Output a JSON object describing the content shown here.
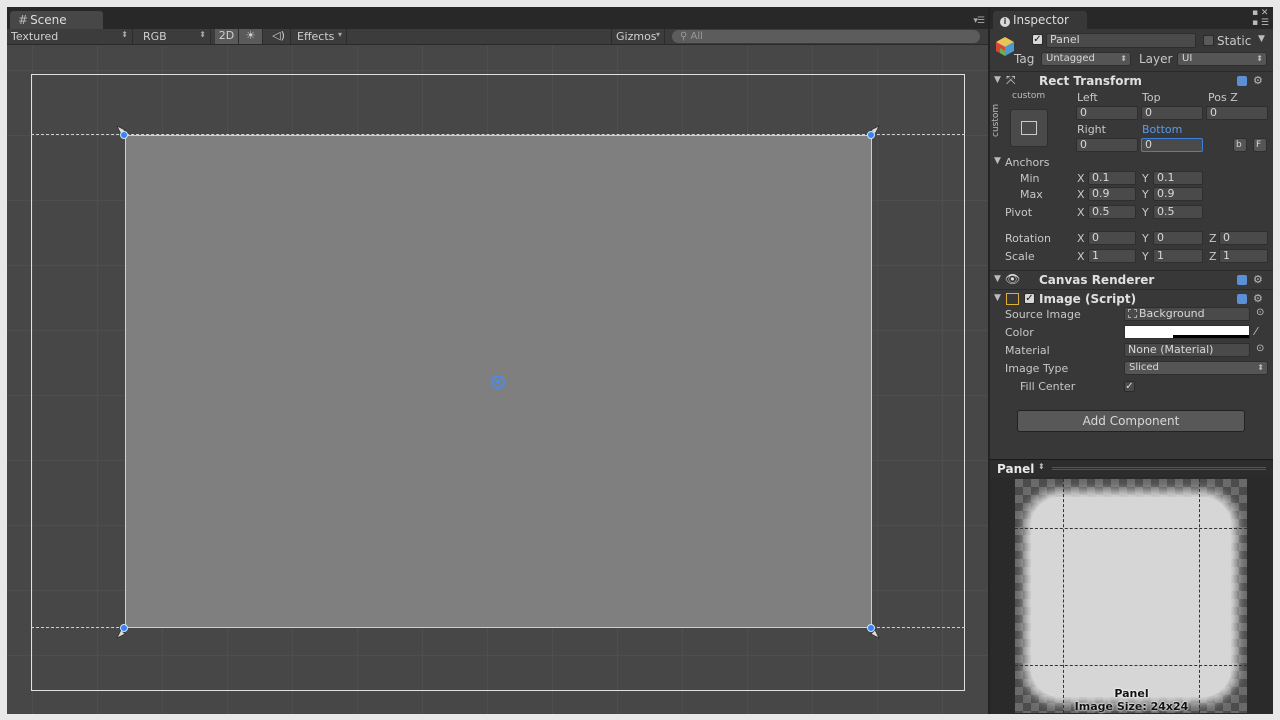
{
  "scene": {
    "tab_label": "Scene",
    "toolbar": {
      "shading_mode": "Textured",
      "render_mode": "RGB",
      "mode_2d": "2D",
      "effects": "Effects",
      "gizmos": "Gizmos",
      "search_placeholder": "All"
    }
  },
  "inspector": {
    "tab_label": "Inspector",
    "object": {
      "name": "Panel",
      "active": true,
      "static_label": "Static",
      "static": false,
      "tag_label": "Tag",
      "tag": "Untagged",
      "layer_label": "Layer",
      "layer": "UI"
    },
    "rect_transform": {
      "title": "Rect Transform",
      "anchor_preset_top": "custom",
      "anchor_preset_side": "custom",
      "left_label": "Left",
      "top_label": "Top",
      "posz_label": "Pos Z",
      "left": "0",
      "top": "0",
      "posz": "0",
      "right_label": "Right",
      "bottom_label": "Bottom",
      "right": "0",
      "bottom": "0",
      "blueprint_btn": "b",
      "raw_btn": "F",
      "anchors_label": "Anchors",
      "min_label": "Min",
      "max_label": "Max",
      "min_x": "0.1",
      "min_y": "0.1",
      "max_x": "0.9",
      "max_y": "0.9",
      "pivot_label": "Pivot",
      "pivot_x": "0.5",
      "pivot_y": "0.5",
      "rotation_label": "Rotation",
      "rot_x": "0",
      "rot_y": "0",
      "rot_z": "0",
      "scale_label": "Scale",
      "scale_x": "1",
      "scale_y": "1",
      "scale_z": "1",
      "x": "X",
      "y": "Y",
      "z": "Z"
    },
    "canvas_renderer": {
      "title": "Canvas Renderer"
    },
    "image": {
      "title": "Image (Script)",
      "enabled": true,
      "source_image_label": "Source Image",
      "source_image": "Background",
      "color_label": "Color",
      "color": "#ffffff",
      "material_label": "Material",
      "material": "None (Material)",
      "image_type_label": "Image Type",
      "image_type": "Sliced",
      "fill_center_label": "Fill Center",
      "fill_center": true
    },
    "add_component": "Add Component",
    "preview": {
      "title": "Panel",
      "caption_name": "Panel",
      "caption_size": "Image Size: 24x24"
    }
  }
}
